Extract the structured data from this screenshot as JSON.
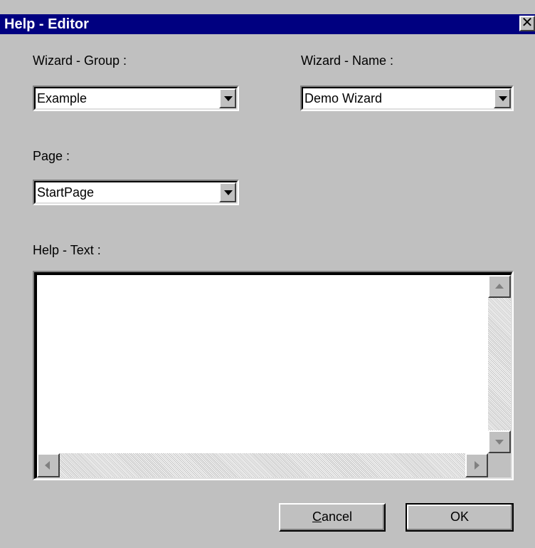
{
  "window": {
    "title": "Help - Editor",
    "close_glyph": "✕"
  },
  "form": {
    "wizard_group": {
      "label": "Wizard - Group :",
      "value": "Example"
    },
    "wizard_name": {
      "label": "Wizard - Name :",
      "value": "Demo Wizard"
    },
    "page": {
      "label": "Page :",
      "value": "StartPage"
    },
    "help_text": {
      "label": "Help - Text :",
      "value": ""
    }
  },
  "buttons": {
    "cancel": {
      "mnemonic": "C",
      "rest": "ancel"
    },
    "ok": {
      "label": "OK"
    }
  },
  "icons": {
    "close": "close-icon",
    "dropdown": "chevron-down-icon",
    "scroll_up": "arrow-up-icon",
    "scroll_down": "arrow-down-icon",
    "scroll_left": "arrow-left-icon",
    "scroll_right": "arrow-right-icon"
  },
  "colors": {
    "titlebar": "#000080",
    "dialog_bg": "#c0c0c0",
    "field_bg": "#ffffff"
  }
}
